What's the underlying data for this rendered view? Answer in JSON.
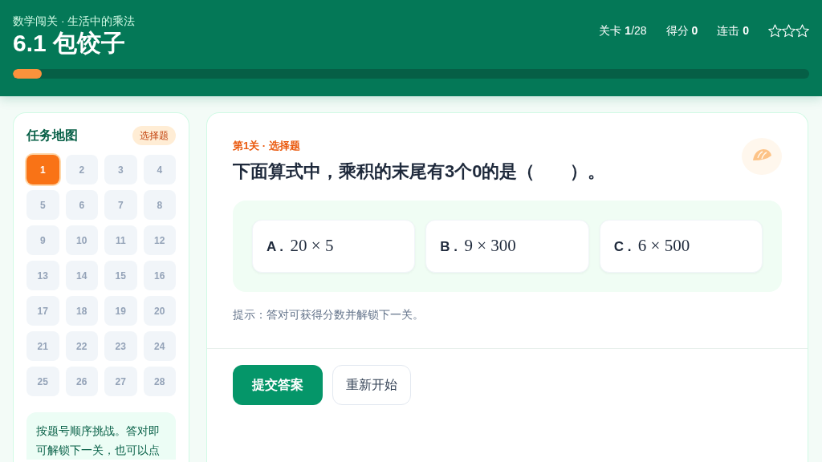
{
  "header": {
    "subtitle": "数学闯关 · 生活中的乘法",
    "title": "6.1 包饺子",
    "stats": [
      {
        "text": "关卡 **1**/28"
      },
      {
        "text": "得分 **0**"
      },
      {
        "text": "连击 **0**"
      }
    ],
    "stars": 0,
    "progress": {
      "level": 0.036
    }
  },
  "sidebar": {
    "title": "任务地图",
    "badge": "选择题",
    "levels": [
      {
        "label": "1",
        "selected": true
      },
      {
        "label": "2",
        "selected": false
      },
      {
        "label": "3",
        "selected": false
      },
      {
        "label": "4",
        "selected": false
      },
      {
        "label": "5",
        "selected": false
      },
      {
        "label": "6",
        "selected": false
      },
      {
        "label": "7",
        "selected": false
      },
      {
        "label": "8",
        "selected": false
      },
      {
        "label": "9",
        "selected": false
      },
      {
        "label": "10",
        "selected": false
      },
      {
        "label": "11",
        "selected": false
      },
      {
        "label": "12",
        "selected": false
      },
      {
        "label": "13",
        "selected": false
      },
      {
        "label": "14",
        "selected": false
      },
      {
        "label": "15",
        "selected": false
      },
      {
        "label": "16",
        "selected": false
      },
      {
        "label": "17",
        "selected": false
      },
      {
        "label": "18",
        "selected": false
      },
      {
        "label": "19",
        "selected": false
      },
      {
        "label": "20",
        "selected": false
      },
      {
        "label": "21",
        "selected": false
      },
      {
        "label": "22",
        "selected": false
      },
      {
        "label": "23",
        "selected": false
      },
      {
        "label": "24",
        "selected": false
      },
      {
        "label": "25",
        "selected": false
      },
      {
        "label": "26",
        "selected": false
      },
      {
        "label": "27",
        "selected": false
      },
      {
        "label": "28",
        "selected": false
      }
    ],
    "note": "按题号顺序挑战。答对即可解锁下一关，也可以点"
  },
  "question": {
    "tag": "第1关 · 选择题",
    "text": "下面算式中，乘积的末尾有3个0的是（　　）。",
    "options": [
      {
        "letter": "A .",
        "expression": "20 × 5",
        "selected": false
      },
      {
        "letter": "B .",
        "expression": "9 × 300",
        "selected": false
      },
      {
        "letter": "C .",
        "expression": "6 × 500",
        "selected": false
      }
    ],
    "hint": "提示：答对可获得分数并解锁下一关。"
  },
  "actions": [
    {
      "label": "提交答案",
      "kind": "primary"
    },
    {
      "label": "重新开始",
      "kind": "secondary"
    }
  ]
}
